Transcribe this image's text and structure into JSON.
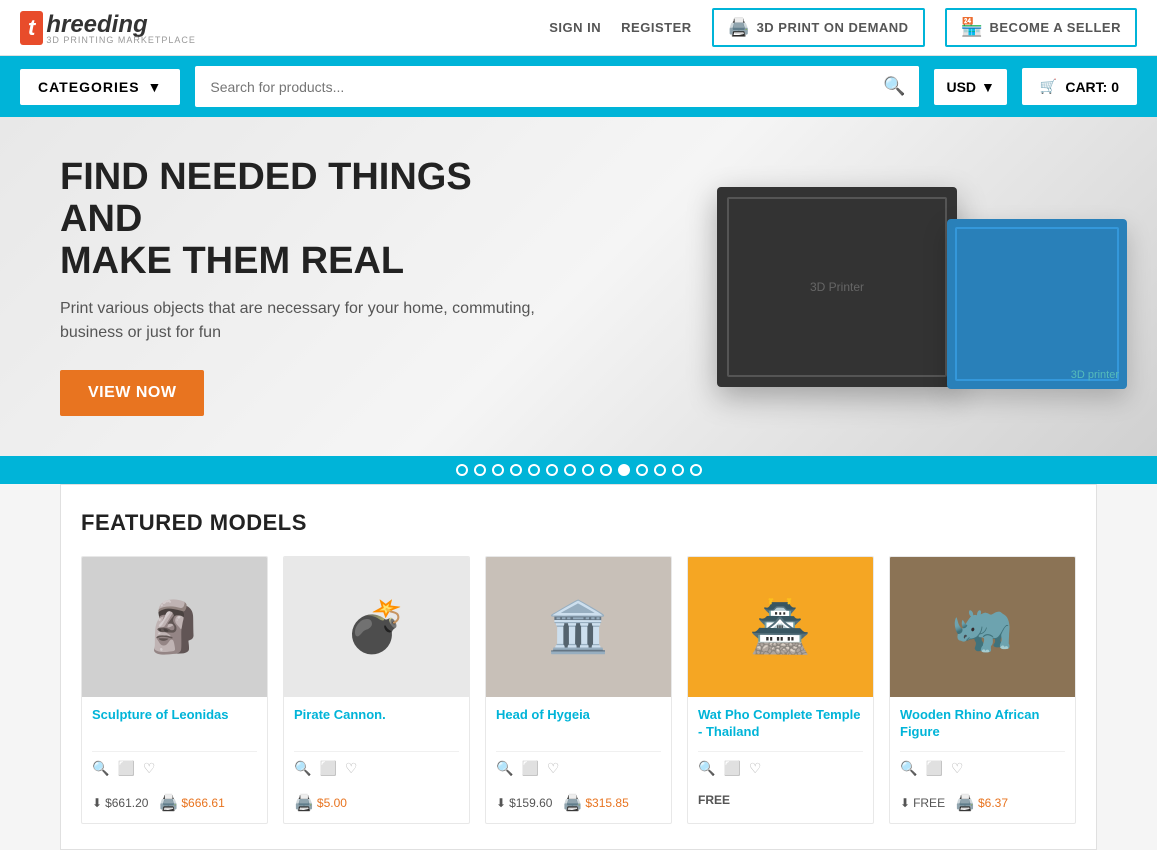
{
  "header": {
    "logo": {
      "icon_letter": "t",
      "text": "hreeding",
      "subtitle": "3D PRINTING MARKETPLACE"
    },
    "nav": {
      "sign_in": "SIGN IN",
      "register": "REGISTER",
      "print_on_demand": "3D PRINT ON DEMAND",
      "become_seller": "BECOME A SELLER"
    }
  },
  "navbar": {
    "categories_label": "CATEGORIES",
    "search_placeholder": "Search for products...",
    "currency": "USD",
    "cart_label": "CART: 0"
  },
  "hero": {
    "headline_line1": "FIND NEEDED THINGS AND",
    "headline_line2": "MAKE THEM REAL",
    "subtext": "Print various objects that are necessary for your home, commuting, business or just for fun",
    "cta_label": "VIEW NOW"
  },
  "carousel": {
    "dots_count": 14,
    "active_index": 9
  },
  "featured": {
    "section_title": "FEATURED MODELS",
    "products": [
      {
        "id": 1,
        "name": "Sculpture of Leonidas",
        "image_emoji": "🗿",
        "image_bg": "#d0d0d0",
        "price_download": "$661.20",
        "price_print": "$666.61",
        "is_free": false
      },
      {
        "id": 2,
        "name": "Pirate Cannon.",
        "image_emoji": "💣",
        "image_bg": "#e8e8e8",
        "price_download": "",
        "price_print": "$5.00",
        "is_free": false,
        "only_print": true
      },
      {
        "id": 3,
        "name": "Head of Hygeia",
        "image_emoji": "🏛️",
        "image_bg": "#c8c0b8",
        "price_download": "$159.60",
        "price_print": "$315.85",
        "is_free": false
      },
      {
        "id": 4,
        "name": "Wat Pho Complete Temple - Thailand",
        "image_emoji": "🏯",
        "image_bg": "#f5a623",
        "price_download": "FREE",
        "price_print": "",
        "is_free": true
      },
      {
        "id": 5,
        "name": "Wooden Rhino African Figure",
        "image_emoji": "🦏",
        "image_bg": "#8B7355",
        "price_download": "FREE",
        "price_print": "$6.37",
        "is_free": true
      }
    ]
  }
}
